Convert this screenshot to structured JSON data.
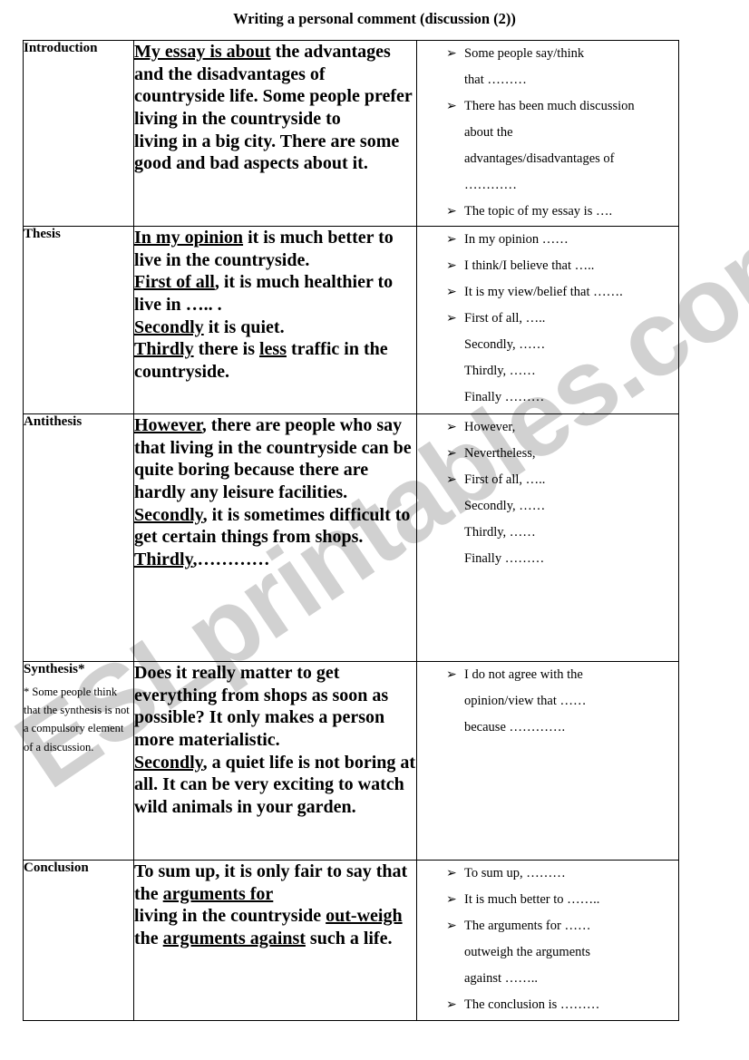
{
  "page": {
    "title": "Writing a personal comment (discussion (2))",
    "watermark": "ESLprintables.com"
  },
  "table": {
    "rows": [
      {
        "label": "Introduction",
        "note": "",
        "model_text_html": "<span class=\"u\">My essay is about</span> the advantages and the disadvantages of countryside life. Some people prefer living in the countryside to<br>living in a big city. There are some good and bad aspects about it.",
        "model_text": "My essay is about the advantages and the disadvantages of countryside life. Some people prefer living in the countryside to living in a big city. There are some good and bad aspects about it.",
        "phrases": [
          {
            "bullet": "➢",
            "lines": [
              "Some people say/think",
              "that ………"
            ]
          },
          {
            "bullet": "➢",
            "lines": [
              "There has been much discussion",
              "about the",
              "advantages/disadvantages of",
              "…………"
            ]
          },
          {
            "bullet": "➢",
            "lines": [
              "The topic of my essay is …."
            ]
          }
        ]
      },
      {
        "label": "Thesis",
        "note": "",
        "model_text_html": "<span class=\"u\">In my opinion</span> it is much better to live in the countryside.<br><span class=\"u\">First of all</span>, it is much healthier to live in ….. .<br><span class=\"u\">Secondly</span> it is quiet.<br><span class=\"u\">Thirdly</span> there is <span class=\"u\">less</span> traffic in the countryside.",
        "model_text": "In my opinion it is much better to live in the countryside. First of all, it is much healthier to live in ..... . Secondly it is quiet. Thirdly there is less traffic in the countryside.",
        "phrases": [
          {
            "bullet": "➢",
            "lines": [
              "In my opinion ……"
            ]
          },
          {
            "bullet": "➢",
            "lines": [
              "I think/I believe that ….."
            ]
          },
          {
            "bullet": "➢",
            "lines": [
              "It is my view/belief that ……."
            ]
          },
          {
            "bullet": "➢",
            "lines": [
              "First of all, …..",
              "Secondly, ……",
              "Thirdly, ……",
              " Finally ………"
            ]
          }
        ]
      },
      {
        "label": "Antithesis",
        "note": "",
        "model_text_html": "<span class=\"u\">However</span>, there are people who say that living in the countryside can be quite boring because there are hardly any leisure facilities.<br><span class=\"u\">Secondly</span>, it is sometimes difficult to get certain things from shops.<br><span class=\"u\">Thirdly</span>,…………",
        "model_text": "However, there are people who say that living in the countryside can be quite boring because there are hardly any leisure facilities. Secondly, it is sometimes difficult to get certain things from shops. Thirdly,............",
        "phrases": [
          {
            "bullet": "➢",
            "lines": [
              "However,"
            ]
          },
          {
            "bullet": "➢",
            "lines": [
              "Nevertheless,"
            ]
          },
          {
            "bullet": "➢",
            "lines": [
              "First of all, …..",
              "Secondly, ……",
              "Thirdly, ……",
              " Finally ………"
            ]
          }
        ]
      },
      {
        "label": "Synthesis*",
        "note": "* Some people think that the synthesis is not a compulsory element of a discussion.",
        "model_text_html": "Does it really matter to get everything from shops as soon as possible? It only makes a person more materialistic.<br><span class=\"u\">Secondly</span>, a quiet life is not boring at all. It can be very exciting to watch wild animals in your garden.",
        "model_text": "Does it really matter to get everything from shops as soon as possible? It only makes a person more materialistic. Secondly, a quiet life is not boring at all. It can be very exciting to watch wild animals in your garden.",
        "phrases": [
          {
            "bullet": "➢",
            "lines": [
              "I do not agree with the",
              "opinion/view that ……",
              "because …………."
            ]
          }
        ]
      },
      {
        "label": "Conclusion",
        "note": "",
        "model_text_html": "To sum up, it is only fair to say that the <span class=\"u\">arguments for</span><br>living in the countryside <span class=\"u\">out-weigh </span> the <span class=\"u\">arguments against</span> such a life.",
        "model_text": "To sum up, it is only fair to say that the arguments for living in the countryside out-weigh the arguments against such a life.",
        "phrases": [
          {
            "bullet": "➢",
            "lines": [
              "To sum up, ………"
            ]
          },
          {
            "bullet": "➢",
            "lines": [
              "It is much better to …….."
            ]
          },
          {
            "bullet": "➢",
            "lines": [
              "The arguments for ……",
              "outweigh the arguments",
              "against …….."
            ]
          },
          {
            "bullet": "➢",
            "lines": [
              " The conclusion is ………"
            ]
          }
        ]
      }
    ]
  }
}
